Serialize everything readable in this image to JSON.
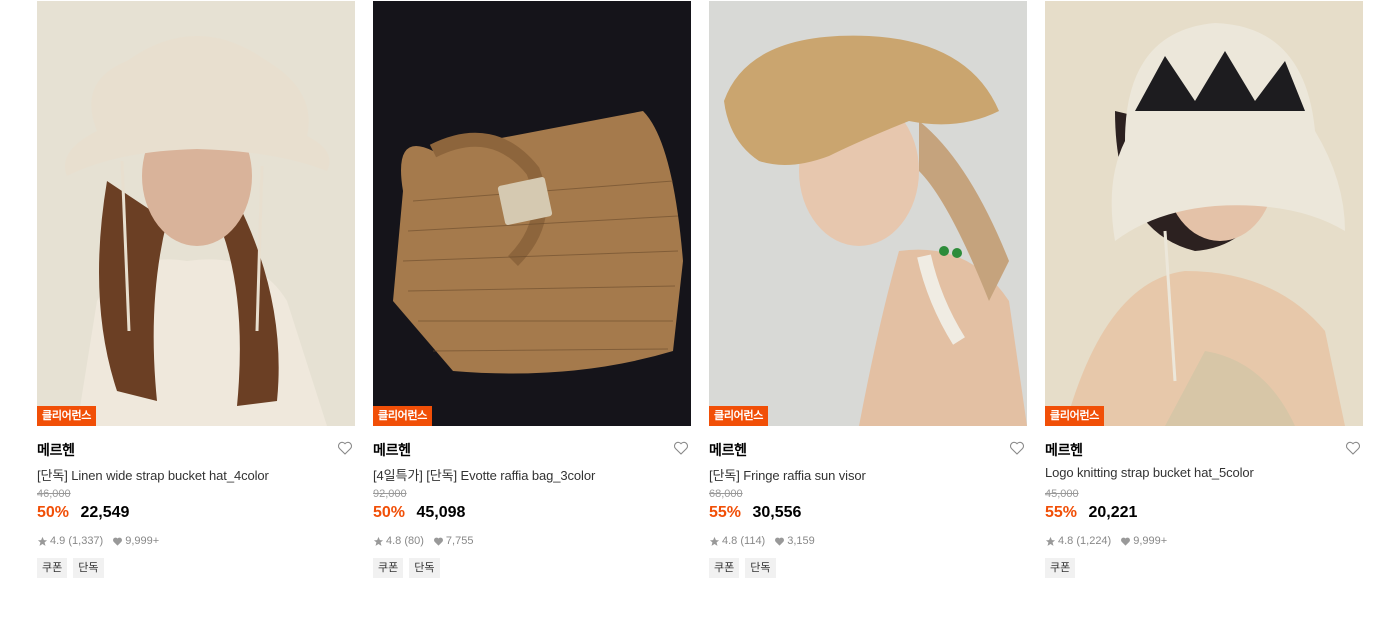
{
  "colors": {
    "accent": "#f14f07",
    "muted": "#999999"
  },
  "products": [
    {
      "badge": "클리어런스",
      "brand": "메르헨",
      "title": "[단독] Linen wide strap bucket hat_4color",
      "original_price": "46,000",
      "discount": "50%",
      "price": "22,549",
      "rating": "4.9",
      "reviews": "(1,337)",
      "likes": "9,999+",
      "tags": [
        "쿠폰",
        "단독"
      ],
      "image_icon": "bucket-hat-photo"
    },
    {
      "badge": "클리어런스",
      "brand": "메르헨",
      "title": "[4일특가] [단독] Evotte raffia bag_3color",
      "original_price": "92,000",
      "discount": "50%",
      "price": "45,098",
      "rating": "4.8",
      "reviews": "(80)",
      "likes": "7,755",
      "tags": [
        "쿠폰",
        "단독"
      ],
      "image_icon": "raffia-bag-photo"
    },
    {
      "badge": "클리어런스",
      "brand": "메르헨",
      "title": "[단독] Fringe raffia sun visor",
      "original_price": "68,000",
      "discount": "55%",
      "price": "30,556",
      "rating": "4.8",
      "reviews": "(114)",
      "likes": "3,159",
      "tags": [
        "쿠폰",
        "단독"
      ],
      "image_icon": "sun-visor-photo"
    },
    {
      "badge": "클리어런스",
      "brand": "메르헨",
      "title": "Logo knitting strap bucket hat_5color",
      "original_price": "45,000",
      "discount": "55%",
      "price": "20,221",
      "rating": "4.8",
      "reviews": "(1,224)",
      "likes": "9,999+",
      "tags": [
        "쿠폰"
      ],
      "image_icon": "knit-bucket-hat-photo"
    }
  ]
}
